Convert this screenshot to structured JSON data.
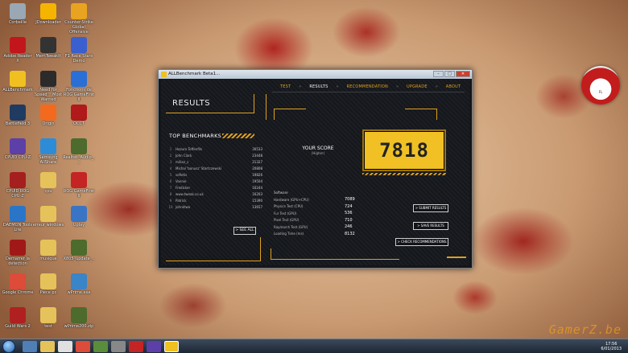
{
  "desktop_icons": [
    {
      "label": "Corbeille",
      "color": "#9aa7b4",
      "icon": "recycle-bin-icon"
    },
    {
      "label": "JDownloader",
      "color": "#f5b400",
      "icon": "jdownloader-icon"
    },
    {
      "label": "Counter-Strike Global Offensive",
      "color": "#e8a420",
      "icon": "csgo-icon"
    },
    {
      "label": "Adobe Reader X",
      "color": "#c3161c",
      "icon": "adobe-reader-icon"
    },
    {
      "label": "MemTweakIt",
      "color": "#333333",
      "icon": "memtweakit-icon"
    },
    {
      "label": "F1 Race Stars Demo",
      "color": "#3a5fcf",
      "icon": "f1-race-stars-icon"
    },
    {
      "label": "ALLBenchmark",
      "color": "#f0c020",
      "icon": "allbenchmark-icon"
    },
    {
      "label": "Need for Speed™ Most Wanted",
      "color": "#2b2b2b",
      "icon": "nfs-icon"
    },
    {
      "label": "Fonctions de ROG GameFirst II",
      "color": "#2a6fd6",
      "icon": "rog-gamefirst-icon"
    },
    {
      "label": "Battlefield 3",
      "color": "#1f3b61",
      "icon": "battlefield-icon"
    },
    {
      "label": "Origin",
      "color": "#f36a1e",
      "icon": "origin-icon"
    },
    {
      "label": "OCCT",
      "color": "#b01a1a",
      "icon": "occt-icon"
    },
    {
      "label": "CPUID CPU-Z",
      "color": "#5d3fa8",
      "icon": "cpuz-icon"
    },
    {
      "label": "Samsung AllShare",
      "color": "#2d8cd8",
      "icon": "allshare-icon"
    },
    {
      "label": "Realtek_Audio_...",
      "color": "#4c6b2c",
      "icon": "winrar-icon"
    },
    {
      "label": "CPUID ROG CPU-Z",
      "color": "#a51f1f",
      "icon": "rog-cpuz-icon"
    },
    {
      "label": "cpu",
      "color": "#e6c25a",
      "icon": "folder-icon"
    },
    {
      "label": "ROG GameFirst II",
      "color": "#c42424",
      "icon": "gamefirst-icon"
    },
    {
      "label": "DAEMON Tools Lite",
      "color": "#2b75c9",
      "icon": "daemon-tools-icon"
    },
    {
      "label": "erreur windows",
      "color": "#e6c25a",
      "icon": "folder-icon"
    },
    {
      "label": "Uplay",
      "color": "#3a74c4",
      "icon": "uplay-icon"
    },
    {
      "label": "Démarrer la détection",
      "color": "#a11818",
      "icon": "detection-icon"
    },
    {
      "label": "musique",
      "color": "#e6c25a",
      "icon": "folder-icon"
    },
    {
      "label": "X805_update_...",
      "color": "#4c6b2c",
      "icon": "winrar-icon"
    },
    {
      "label": "Google Chrome",
      "color": "#dd4b39",
      "icon": "chrome-icon"
    },
    {
      "label": "Pièce pc",
      "color": "#e6c25a",
      "icon": "folder-icon"
    },
    {
      "label": "wPrime.exe",
      "color": "#3a84c8",
      "icon": "wprime-icon"
    },
    {
      "label": "Guild Wars 2",
      "color": "#b02020",
      "icon": "guild-wars-icon"
    },
    {
      "label": "test",
      "color": "#e6c25a",
      "icon": "folder-icon"
    },
    {
      "label": "wPrime200.zip",
      "color": "#4c6b2c",
      "icon": "winrar-icon"
    }
  ],
  "window": {
    "title": "ALLBenchmark Beta1..."
  },
  "nav": {
    "tabs": [
      "TEST",
      "RESULTS",
      "RECOMMENDATION",
      "UPGRADE",
      "ABOUT"
    ],
    "active": "RESULTS"
  },
  "results": {
    "heading": "RESULTS",
    "top_title": "TOP BENCHMARKS",
    "top": [
      {
        "rank": "1",
        "name": "Hazuro Toffenfils",
        "score": "30533"
      },
      {
        "rank": "2",
        "name": "John Clark",
        "score": "23448"
      },
      {
        "rank": "3",
        "name": "milian_s",
        "score": "21327"
      },
      {
        "rank": "4",
        "name": "Michal 'bonusz' Startczewski",
        "score": "20808"
      },
      {
        "rank": "5",
        "name": "sofietis",
        "score": "19826"
      },
      {
        "rank": "6",
        "name": "Vannie",
        "score": "19504"
      },
      {
        "rank": "7",
        "name": "Fredicker",
        "score": "16244"
      },
      {
        "rank": "8",
        "name": "www.tweak.co.uk",
        "score": "16203"
      },
      {
        "rank": "9",
        "name": "Patrick",
        "score": "15390"
      },
      {
        "rank": "10",
        "name": "johnktwo",
        "score": "13657"
      }
    ],
    "see_all": "> SEE ALL",
    "your_score": "YOUR SCORE",
    "your_score_sub": "(Higher)",
    "score": "7818",
    "details_head": "Software",
    "details": [
      {
        "label": "Hardware (GPU+CPU)",
        "value": "7089"
      },
      {
        "label": "Physics Test (CPU)",
        "value": "724"
      },
      {
        "label": "Fur Test (GPU)",
        "value": "536"
      },
      {
        "label": "Pixel Test (GPU)",
        "value": "710"
      },
      {
        "label": "Raymarch Test (GPU)",
        "value": "246"
      },
      {
        "label": "Loading Time (ms)",
        "value": "8132"
      }
    ],
    "submit": "> SUBMIT RESULTS",
    "save": "> SAVE RESULTS",
    "check": "> CHECK RECOMMENDATIONS"
  },
  "gadget": {
    "label": "FL"
  },
  "taskbar": {
    "time": "17:56",
    "date": "6/01/2013"
  },
  "watermark": "GamerZ.be",
  "colors": {
    "accent": "#e0a020",
    "score_box": "#f0c024"
  }
}
